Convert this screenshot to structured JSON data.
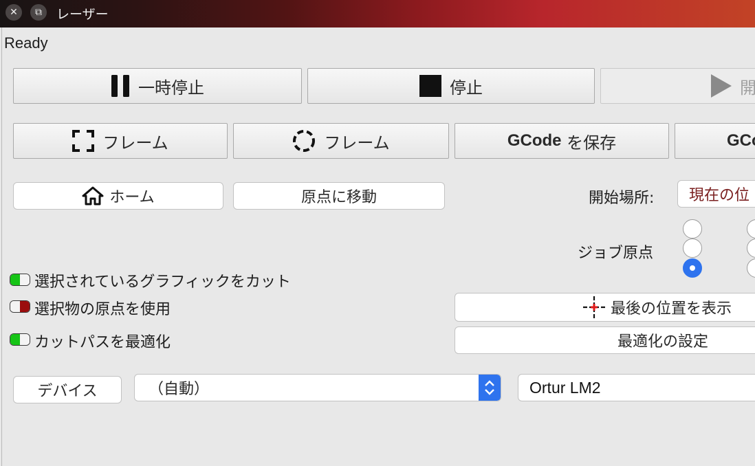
{
  "window": {
    "title": "レーザー"
  },
  "status": "Ready",
  "controls": {
    "pause": "一時停止",
    "stop": "停止",
    "start": "開"
  },
  "frame": {
    "frame_rect": "フレーム",
    "frame_circle": "フレーム",
    "save_gcode_bold": "GCode",
    "save_gcode_rest": " を保存",
    "send_gcode": "GCo"
  },
  "nav": {
    "home": "ホーム",
    "go_origin": "原点に移動"
  },
  "start_from": {
    "label": "開始場所:",
    "value": "現在の位"
  },
  "job_origin": {
    "label": "ジョブ原点"
  },
  "options": [
    {
      "label": "選択されているグラフィックをカット",
      "on": true
    },
    {
      "label": "選択物の原点を使用",
      "on": false
    },
    {
      "label": "カットパスを最適化",
      "on": true
    }
  ],
  "show_last": "最後の位置を表示",
  "optimize_settings": "最適化の設定",
  "device": {
    "button": "デバイス",
    "port": "（自動）",
    "name": "Ortur LM2"
  },
  "colors": {
    "toggle_on": "#16c416",
    "toggle_off": "#9b0d0d",
    "radio_on": "#2e73ee"
  }
}
